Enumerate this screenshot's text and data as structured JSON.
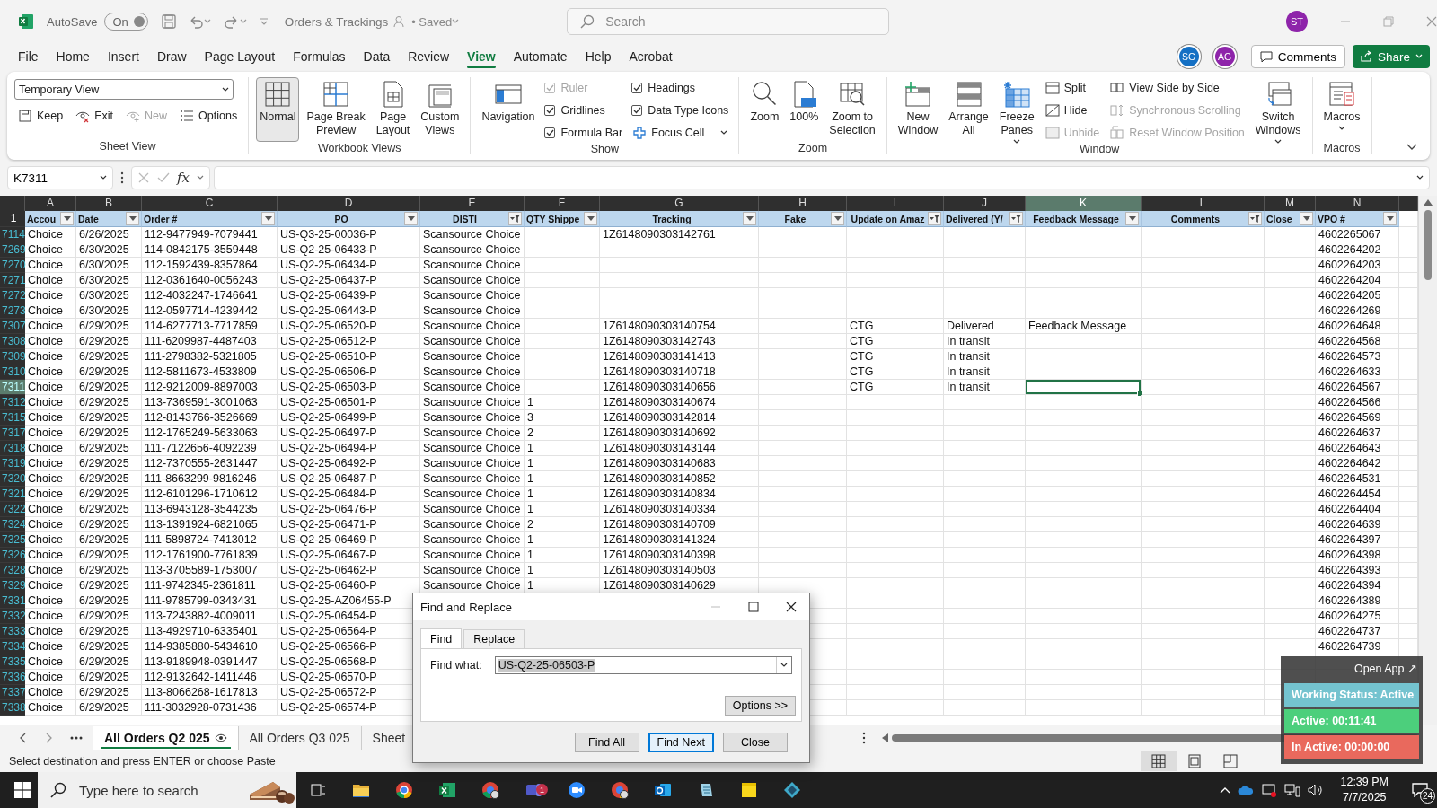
{
  "title_bar": {
    "autosave_label": "AutoSave",
    "autosave": {
      "label": "On",
      "on": true,
      "disabled": true
    },
    "document_title": "Orders & Trackings",
    "save_status": "• Saved",
    "search": {
      "placeholder": "Search"
    },
    "user_avatar": "ST"
  },
  "menu_tabs": [
    {
      "label": "File",
      "selected": false
    },
    {
      "label": "Home",
      "selected": false
    },
    {
      "label": "Insert",
      "selected": false
    },
    {
      "label": "Draw",
      "selected": false
    },
    {
      "label": "Page Layout",
      "selected": false
    },
    {
      "label": "Formulas",
      "selected": false
    },
    {
      "label": "Data",
      "selected": false
    },
    {
      "label": "Review",
      "selected": false
    },
    {
      "label": "View",
      "selected": true
    },
    {
      "label": "Automate",
      "selected": false
    },
    {
      "label": "Help",
      "selected": false
    },
    {
      "label": "Acrobat",
      "selected": false
    }
  ],
  "collaborators": [
    {
      "initials": "SG",
      "color": "#1570c4"
    },
    {
      "initials": "AG",
      "color": "#8e24aa"
    }
  ],
  "comments_button": "Comments",
  "share_button": "Share",
  "ribbon": {
    "groups": [
      {
        "label": "Sheet View",
        "stacks": [
          [
            {
              "kind": "dropdown",
              "label": "Temporary View"
            }
          ],
          [
            {
              "kind": "small",
              "label": "Keep",
              "disabled": false,
              "has_menu": false
            },
            {
              "kind": "small",
              "label": "Exit",
              "disabled": false,
              "has_menu": false
            },
            {
              "kind": "small",
              "label": "New",
              "disabled": true,
              "has_menu": false
            },
            {
              "kind": "small",
              "label": "Options",
              "disabled": false,
              "has_menu": false
            }
          ]
        ]
      },
      {
        "label": "Workbook Views",
        "stacks": [
          [
            {
              "kind": "large",
              "label": "Normal",
              "selected": true,
              "has_menu": false
            }
          ],
          [
            {
              "kind": "large",
              "label": "Page Break Preview",
              "selected": false,
              "has_menu": false
            }
          ],
          [
            {
              "kind": "large",
              "label": "Page Layout",
              "selected": false,
              "has_menu": false
            }
          ],
          [
            {
              "kind": "large",
              "label": "Custom Views",
              "selected": false,
              "has_menu": false
            }
          ]
        ]
      },
      {
        "label": "Show",
        "stacks": [
          [
            {
              "kind": "large",
              "label": "Navigation",
              "has_menu": false
            }
          ],
          [
            {
              "kind": "check",
              "label": "Ruler",
              "checked": true,
              "disabled": true
            },
            {
              "kind": "check",
              "label": "Gridlines",
              "checked": true,
              "disabled": false
            },
            {
              "kind": "check",
              "label": "Formula Bar",
              "checked": true,
              "disabled": false
            }
          ],
          [
            {
              "kind": "check",
              "label": "Headings",
              "checked": true,
              "disabled": false
            },
            {
              "kind": "check",
              "label": "Data Type Icons",
              "checked": true,
              "disabled": false
            },
            {
              "kind": "small",
              "label": "Focus Cell",
              "disabled": false,
              "has_menu": true
            }
          ]
        ]
      },
      {
        "label": "Zoom",
        "stacks": [
          [
            {
              "kind": "large",
              "label": "Zoom",
              "has_menu": false
            }
          ],
          [
            {
              "kind": "large",
              "label": "100%",
              "has_menu": false
            }
          ],
          [
            {
              "kind": "large",
              "label": "Zoom to Selection",
              "has_menu": false
            }
          ]
        ]
      },
      {
        "label": "Window",
        "stacks": [
          [
            {
              "kind": "large",
              "label": "New Window",
              "has_menu": false
            }
          ],
          [
            {
              "kind": "large",
              "label": "Arrange All",
              "has_menu": false
            }
          ],
          [
            {
              "kind": "large",
              "label": "Freeze Panes",
              "has_menu": true
            }
          ],
          [
            {
              "kind": "small",
              "label": "Split",
              "disabled": false,
              "has_menu": false
            },
            {
              "kind": "small",
              "label": "Hide",
              "disabled": false,
              "has_menu": false
            },
            {
              "kind": "small",
              "label": "Unhide",
              "disabled": true,
              "has_menu": false
            }
          ],
          [
            {
              "kind": "small",
              "label": "View Side by Side",
              "disabled": false,
              "has_menu": false
            },
            {
              "kind": "small",
              "label": "Synchronous Scrolling",
              "disabled": true,
              "has_menu": false
            },
            {
              "kind": "small",
              "label": "Reset Window Position",
              "disabled": true,
              "has_menu": false
            }
          ],
          [
            {
              "kind": "large",
              "label": "Switch Windows",
              "has_menu": true
            }
          ]
        ]
      },
      {
        "label": "Macros",
        "stacks": [
          [
            {
              "kind": "large",
              "label": "Macros",
              "has_menu": true
            }
          ]
        ]
      }
    ]
  },
  "formula_bar": {
    "name_box": "K7311",
    "function_label": "fx"
  },
  "grid": {
    "header_row_number": "1",
    "columns": [
      {
        "letter": "A",
        "header": "Accou",
        "filtered": false,
        "selected": false
      },
      {
        "letter": "B",
        "header": "Date",
        "filtered": false,
        "selected": false
      },
      {
        "letter": "C",
        "header": "Order #",
        "filtered": false,
        "selected": false
      },
      {
        "letter": "D",
        "header": "PO",
        "filtered": false,
        "selected": false
      },
      {
        "letter": "E",
        "header": "DISTI",
        "filtered": true,
        "selected": false
      },
      {
        "letter": "F",
        "header": "QTY Shippe",
        "filtered": false,
        "selected": false
      },
      {
        "letter": "G",
        "header": "Tracking",
        "filtered": false,
        "selected": false
      },
      {
        "letter": "H",
        "header": "Fake",
        "filtered": false,
        "selected": false
      },
      {
        "letter": "I",
        "header": "Update on Amaz",
        "filtered": true,
        "selected": false
      },
      {
        "letter": "J",
        "header": "Delivered (Y/",
        "filtered": true,
        "selected": false
      },
      {
        "letter": "K",
        "header": "Feedback Message",
        "filtered": false,
        "selected": true
      },
      {
        "letter": "L",
        "header": "Comments",
        "filtered": true,
        "selected": false
      },
      {
        "letter": "M",
        "header": "Close",
        "filtered": false,
        "selected": false
      },
      {
        "letter": "N",
        "header": "VPO #",
        "filtered": false,
        "selected": false
      }
    ],
    "rows": [
      {
        "number": "7114",
        "selected": false,
        "cells": {
          "A": "Choice",
          "B": "6/26/2025",
          "C": "112-9477949-7079441",
          "D": "US-Q3-25-00036-P",
          "E": "Scansource Choice",
          "G": "1Z6148090303142761",
          "N": "4602265067"
        }
      },
      {
        "number": "7269",
        "selected": false,
        "cells": {
          "A": "Choice",
          "B": "6/30/2025",
          "C": "114-0842175-3559448",
          "D": "US-Q2-25-06433-P",
          "E": "Scansource Choice",
          "N": "4602264202"
        }
      },
      {
        "number": "7270",
        "selected": false,
        "cells": {
          "A": "Choice",
          "B": "6/30/2025",
          "C": "112-1592439-8357864",
          "D": "US-Q2-25-06434-P",
          "E": "Scansource Choice",
          "N": "4602264203"
        }
      },
      {
        "number": "7271",
        "selected": false,
        "cells": {
          "A": "Choice",
          "B": "6/30/2025",
          "C": "112-0361640-0056243",
          "D": "US-Q2-25-06437-P",
          "E": "Scansource Choice",
          "N": "4602264204"
        }
      },
      {
        "number": "7272",
        "selected": false,
        "cells": {
          "A": "Choice",
          "B": "6/30/2025",
          "C": "112-4032247-1746641",
          "D": "US-Q2-25-06439-P",
          "E": "Scansource Choice",
          "N": "4602264205"
        }
      },
      {
        "number": "7273",
        "selected": false,
        "cells": {
          "A": "Choice",
          "B": "6/30/2025",
          "C": "112-0597714-4239442",
          "D": "US-Q2-25-06443-P",
          "E": "Scansource Choice",
          "N": "4602264269"
        }
      },
      {
        "number": "7307",
        "selected": false,
        "cells": {
          "A": "Choice",
          "B": "6/29/2025",
          "C": "114-6277713-7717859",
          "D": "US-Q2-25-06520-P",
          "E": "Scansource Choice",
          "G": "1Z6148090303140754",
          "I": "CTG",
          "J": "Delivered",
          "K": "Feedback Message",
          "N": "4602264648"
        }
      },
      {
        "number": "7308",
        "selected": false,
        "cells": {
          "A": "Choice",
          "B": "6/29/2025",
          "C": "111-6209987-4487403",
          "D": "US-Q2-25-06512-P",
          "E": "Scansource Choice",
          "G": "1Z6148090303142743",
          "I": "CTG",
          "J": "In transit",
          "N": "4602264568"
        }
      },
      {
        "number": "7309",
        "selected": false,
        "cells": {
          "A": "Choice",
          "B": "6/29/2025",
          "C": "111-2798382-5321805",
          "D": "US-Q2-25-06510-P",
          "E": "Scansource Choice",
          "G": "1Z6148090303141413",
          "I": "CTG",
          "J": "In transit",
          "N": "4602264573"
        }
      },
      {
        "number": "7310",
        "selected": false,
        "cells": {
          "A": "Choice",
          "B": "6/29/2025",
          "C": "112-5811673-4533809",
          "D": "US-Q2-25-06506-P",
          "E": "Scansource Choice",
          "G": "1Z6148090303140718",
          "I": "CTG",
          "J": "In transit",
          "N": "4602264633"
        }
      },
      {
        "number": "7311",
        "selected": true,
        "cells": {
          "A": "Choice",
          "B": "6/29/2025",
          "C": "112-9212009-8897003",
          "D": "US-Q2-25-06503-P",
          "E": "Scansource Choice",
          "G": "1Z6148090303140656",
          "I": "CTG",
          "J": "In transit",
          "N": "4602264567"
        }
      },
      {
        "number": "7312",
        "selected": false,
        "cells": {
          "A": "Choice",
          "B": "6/29/2025",
          "C": "113-7369591-3001063",
          "D": "US-Q2-25-06501-P",
          "E": "Scansource Choice",
          "F": "1",
          "G": "1Z6148090303140674",
          "N": "4602264566"
        }
      },
      {
        "number": "7315",
        "selected": false,
        "cells": {
          "A": "Choice",
          "B": "6/29/2025",
          "C": "112-8143766-3526669",
          "D": "US-Q2-25-06499-P",
          "E": "Scansource Choice",
          "F": "3",
          "G": "1Z6148090303142814",
          "N": "4602264569"
        }
      },
      {
        "number": "7317",
        "selected": false,
        "cells": {
          "A": "Choice",
          "B": "6/29/2025",
          "C": "112-1765249-5633063",
          "D": "US-Q2-25-06497-P",
          "E": "Scansource Choice",
          "F": "2",
          "G": "1Z6148090303140692",
          "N": "4602264637"
        }
      },
      {
        "number": "7318",
        "selected": false,
        "cells": {
          "A": "Choice",
          "B": "6/29/2025",
          "C": "111-7122656-4092239",
          "D": "US-Q2-25-06494-P",
          "E": "Scansource Choice",
          "F": "1",
          "G": "1Z6148090303143144",
          "N": "4602264643"
        }
      },
      {
        "number": "7319",
        "selected": false,
        "cells": {
          "A": "Choice",
          "B": "6/29/2025",
          "C": "112-7370555-2631447",
          "D": "US-Q2-25-06492-P",
          "E": "Scansource Choice",
          "F": "1",
          "G": "1Z6148090303140683",
          "N": "4602264642"
        }
      },
      {
        "number": "7320",
        "selected": false,
        "cells": {
          "A": "Choice",
          "B": "6/29/2025",
          "C": "111-8663299-9816246",
          "D": "US-Q2-25-06487-P",
          "E": "Scansource Choice",
          "F": "1",
          "G": "1Z6148090303140852",
          "N": "4602264531"
        }
      },
      {
        "number": "7321",
        "selected": false,
        "cells": {
          "A": "Choice",
          "B": "6/29/2025",
          "C": "112-6101296-1710612",
          "D": "US-Q2-25-06484-P",
          "E": "Scansource Choice",
          "F": "1",
          "G": "1Z6148090303140834",
          "N": "4602264454"
        }
      },
      {
        "number": "7322",
        "selected": false,
        "cells": {
          "A": "Choice",
          "B": "6/29/2025",
          "C": "113-6943128-3544235",
          "D": "US-Q2-25-06476-P",
          "E": "Scansource Choice",
          "F": "1",
          "G": "1Z6148090303140334",
          "N": "4602264404"
        }
      },
      {
        "number": "7324",
        "selected": false,
        "cells": {
          "A": "Choice",
          "B": "6/29/2025",
          "C": "113-1391924-6821065",
          "D": "US-Q2-25-06471-P",
          "E": "Scansource Choice",
          "F": "2",
          "G": "1Z6148090303140709",
          "N": "4602264639"
        }
      },
      {
        "number": "7325",
        "selected": false,
        "cells": {
          "A": "Choice",
          "B": "6/29/2025",
          "C": "111-5898724-7413012",
          "D": "US-Q2-25-06469-P",
          "E": "Scansource Choice",
          "F": "1",
          "G": "1Z6148090303141324",
          "N": "4602264397"
        }
      },
      {
        "number": "7326",
        "selected": false,
        "cells": {
          "A": "Choice",
          "B": "6/29/2025",
          "C": "112-1761900-7761839",
          "D": "US-Q2-25-06467-P",
          "E": "Scansource Choice",
          "F": "1",
          "G": "1Z6148090303140398",
          "N": "4602264398"
        }
      },
      {
        "number": "7328",
        "selected": false,
        "cells": {
          "A": "Choice",
          "B": "6/29/2025",
          "C": "113-3705589-1753007",
          "D": "US-Q2-25-06462-P",
          "E": "Scansource Choice",
          "F": "1",
          "G": "1Z6148090303140503",
          "N": "4602264393"
        }
      },
      {
        "number": "7329",
        "selected": false,
        "cells": {
          "A": "Choice",
          "B": "6/29/2025",
          "C": "111-9742345-2361811",
          "D": "US-Q2-25-06460-P",
          "E": "Scansource Choice",
          "F": "1",
          "G": "1Z6148090303140629",
          "N": "4602264394"
        }
      },
      {
        "number": "7331",
        "selected": false,
        "cells": {
          "A": "Choice",
          "B": "6/29/2025",
          "C": "111-9785799-0343431",
          "D": "US-Q2-25-AZ06455-P",
          "N": "4602264389"
        }
      },
      {
        "number": "7332",
        "selected": false,
        "cells": {
          "A": "Choice",
          "B": "6/29/2025",
          "C": "113-7243882-4009011",
          "D": "US-Q2-25-06454-P",
          "N": "4602264275"
        }
      },
      {
        "number": "7333",
        "selected": false,
        "cells": {
          "A": "Choice",
          "B": "6/29/2025",
          "C": "113-4929710-6335401",
          "D": "US-Q2-25-06564-P",
          "N": "4602264737"
        }
      },
      {
        "number": "7334",
        "selected": false,
        "cells": {
          "A": "Choice",
          "B": "6/29/2025",
          "C": "114-9385880-5434610",
          "D": "US-Q2-25-06566-P",
          "N": "4602264739"
        }
      },
      {
        "number": "7335",
        "selected": false,
        "cells": {
          "A": "Choice",
          "B": "6/29/2025",
          "C": "113-9189948-0391447",
          "D": "US-Q2-25-06568-P"
        }
      },
      {
        "number": "7336",
        "selected": false,
        "cells": {
          "A": "Choice",
          "B": "6/29/2025",
          "C": "112-9132642-1411446",
          "D": "US-Q2-25-06570-P"
        }
      },
      {
        "number": "7337",
        "selected": false,
        "cells": {
          "A": "Choice",
          "B": "6/29/2025",
          "C": "113-8066268-1617813",
          "D": "US-Q2-25-06572-P"
        }
      },
      {
        "number": "7338",
        "selected": false,
        "cells": {
          "A": "Choice",
          "B": "6/29/2025",
          "C": "111-3032928-0731436",
          "D": "US-Q2-25-06574-P"
        }
      }
    ]
  },
  "sheet_tabs": [
    {
      "label": "All Orders Q2 025",
      "selected": true
    },
    {
      "label": "All Orders Q3 025",
      "selected": false
    },
    {
      "label": "Sheet",
      "selected": false
    }
  ],
  "status_bar": {
    "message": "Select destination and press ENTER or choose Paste"
  },
  "find_dialog": {
    "title": "Find and Replace",
    "tabs": [
      {
        "label": "Find",
        "selected": true
      },
      {
        "label": "Replace",
        "selected": false
      }
    ],
    "find_label": "Find what:",
    "find_value": "US-Q2-25-06503-P",
    "options_button": "Options >>",
    "buttons": [
      {
        "label": "Find All",
        "default": false
      },
      {
        "label": "Find Next",
        "default": true
      },
      {
        "label": "Close",
        "default": false
      }
    ]
  },
  "timer_widget": {
    "open_link": "Open App ↗",
    "statuses": [
      {
        "label": "Working Status: Active",
        "color": "#74c3cf"
      },
      {
        "label": "Active: 00:11:41",
        "color": "#4ccf7c"
      },
      {
        "label": "In Active: 00:00:00",
        "color": "#e9695d"
      }
    ]
  },
  "taskbar": {
    "search": {
      "placeholder": "Type here to search"
    },
    "chat_badge": "1",
    "time": "12:39 PM",
    "date": "7/7/2025",
    "notification_count": "24"
  }
}
